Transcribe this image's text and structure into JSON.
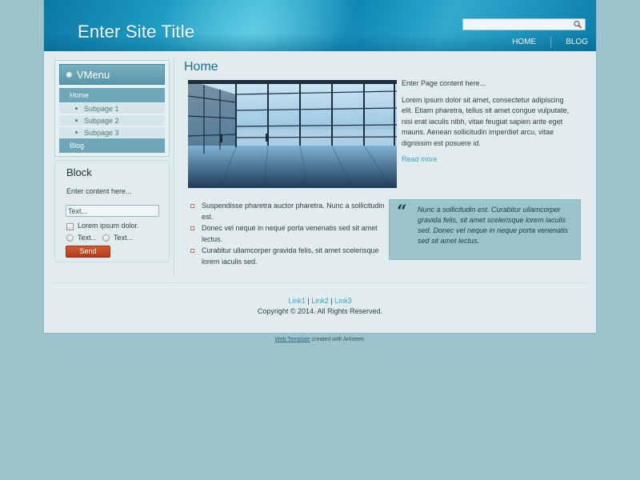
{
  "header": {
    "site_title": "Enter Site Title",
    "search": {
      "value": "",
      "icon": "search-icon"
    },
    "nav": [
      {
        "label": "HOME"
      },
      {
        "label": "BLOG"
      }
    ]
  },
  "sidebar": {
    "vmenu": {
      "title": "VMenu",
      "items": [
        {
          "label": "Home",
          "level": 1
        },
        {
          "label": "Subpage 1",
          "level": 2
        },
        {
          "label": "Subpage 2",
          "level": 2
        },
        {
          "label": "Subpage 3",
          "level": 2
        },
        {
          "label": "Blog",
          "level": 1
        }
      ]
    },
    "block": {
      "title": "Block",
      "text": "Enter content here...",
      "input_value": "Text...",
      "checkbox_label": "Lorem ipsum dolor.",
      "radio_labels": [
        "Text...",
        "Text..."
      ],
      "send_label": "Send"
    }
  },
  "main": {
    "page_title": "Home",
    "intro_lead": "Enter Page content here...",
    "intro_body": "Lorem ipsum dolor sit amet, consectetur adipiscing elit. Etiam pharetra, tellus sit amet congue vulputate, nisi erat iaculis nibh, vitae feugiat sapien ante eget mauris. Aenean sollicitudin imperdiet arcu, vitae dignissim est posuere id.",
    "read_more": "Read more",
    "bullets": [
      "Suspendisse pharetra auctor pharetra. Nunc a sollicitudin est.",
      "Donec vel neque in neque porta venenatis sed sit amet lectus.",
      "Curabitur ullamcorper gravida felis, sit amet scelerisque lorem iaculis sed."
    ],
    "quote": "Nunc a sollicitudin est. Curabitur ullamcorper gravida felis, sit amet scelerisque lorem iaculis sed. Donec vel neque in neque porta venenatis sed sit amet lectus."
  },
  "footer": {
    "links": [
      "Link1",
      "Link2",
      "Link3"
    ],
    "separator": "|",
    "copyright": "Copyright © 2014. All Rights Reserved."
  },
  "credit": {
    "link": "Web Template",
    "text": " created with Artisteer."
  },
  "colors": {
    "background": "#9dc4cc",
    "header": "#0a78a2",
    "accent_link": "#3aa3c4",
    "send_button": "#b23d1a"
  }
}
